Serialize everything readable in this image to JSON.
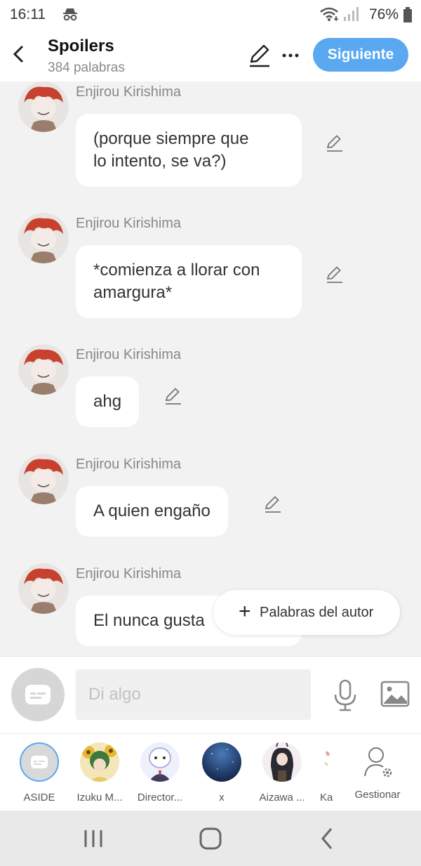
{
  "status_bar": {
    "time": "16:11",
    "battery": "76%"
  },
  "header": {
    "title": "Spoilers",
    "word_count": "384 palabras",
    "next_label": "Siguiente"
  },
  "messages": [
    {
      "author": "Enjirou Kirishima",
      "text": "(porque siempre que\nlo intento, se va?)"
    },
    {
      "author": "Enjirou Kirishima",
      "text": "*comienza a llorar con\namargura*"
    },
    {
      "author": "Enjirou Kirishima",
      "text": "ahg"
    },
    {
      "author": "Enjirou Kirishima",
      "text": "A quien engaño"
    },
    {
      "author": "Enjirou Kirishima",
      "text": "El nunca gusta"
    }
  ],
  "author_words_button": {
    "label": "Palabras del autor"
  },
  "composer": {
    "placeholder": "Di algo"
  },
  "characters": [
    {
      "label": "ASIDE"
    },
    {
      "label": "Izuku M..."
    },
    {
      "label": "Director..."
    },
    {
      "label": "x"
    },
    {
      "label": "Aizawa ..."
    },
    {
      "label": "Ka"
    },
    {
      "label": "Gestionar"
    }
  ],
  "colors": {
    "accent": "#5aa9f0",
    "avatar_hair": "#c8412e",
    "background": "#f2f2f2"
  },
  "icons": {
    "incognito": "incognito-icon",
    "wifi": "wifi-icon",
    "signal": "signal-icon",
    "battery": "battery-icon",
    "back": "chevron-left-icon",
    "edit": "pencil-icon",
    "more": "more-horizontal-icon",
    "plus": "plus-icon",
    "mic": "microphone-icon",
    "image": "image-icon",
    "manage": "user-gear-icon"
  }
}
